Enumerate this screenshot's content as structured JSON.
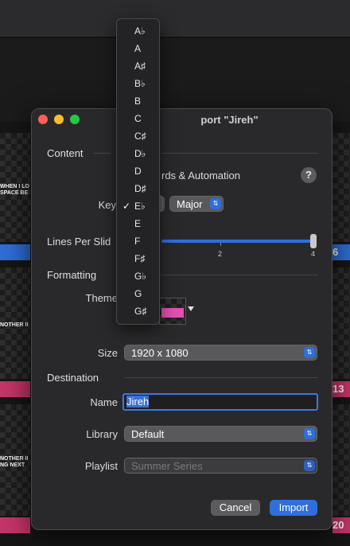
{
  "dialog": {
    "title": "Import \"Jireh\"",
    "title_visible": "port \"Jireh\""
  },
  "content": {
    "section_label": "Content",
    "checkbox_label_visible": "rds & Automation",
    "help_label": "?",
    "key_label": "Key",
    "key_value": "E♭",
    "mode_value": "Major",
    "lines_label": "Lines Per Slide",
    "lines_label_visible": "Lines Per Slid",
    "slider": {
      "min": 1,
      "max": 4,
      "value": 4,
      "ticks": [
        "2",
        "4"
      ]
    }
  },
  "formatting": {
    "section_label": "Formatting",
    "theme_label": "Theme",
    "size_label": "Size",
    "size_value": "1920 x 1080"
  },
  "destination": {
    "section_label": "Destination",
    "name_label": "Name",
    "name_value": "Jireh",
    "library_label": "Library",
    "library_value": "Default",
    "playlist_label": "Playlist",
    "playlist_value": "Summer Series"
  },
  "buttons": {
    "cancel": "Cancel",
    "import": "Import"
  },
  "key_menu": {
    "selected": "E♭",
    "items": [
      "A♭",
      "A",
      "A♯",
      "B♭",
      "B",
      "C",
      "C♯",
      "D♭",
      "D",
      "D♯",
      "E♭",
      "E",
      "F",
      "F♯",
      "G♭",
      "G",
      "G♯"
    ]
  },
  "background": {
    "slide_texts": [
      "WHEN I LO",
      "SPACE BE",
      "NOTHER II",
      "NOTHER II",
      "NG NEXT"
    ],
    "bar_numbers": [
      "6",
      "13",
      "20"
    ],
    "colors": {
      "blue_bar": "#2f6fdb",
      "pink_bar": "#c8356a"
    }
  }
}
